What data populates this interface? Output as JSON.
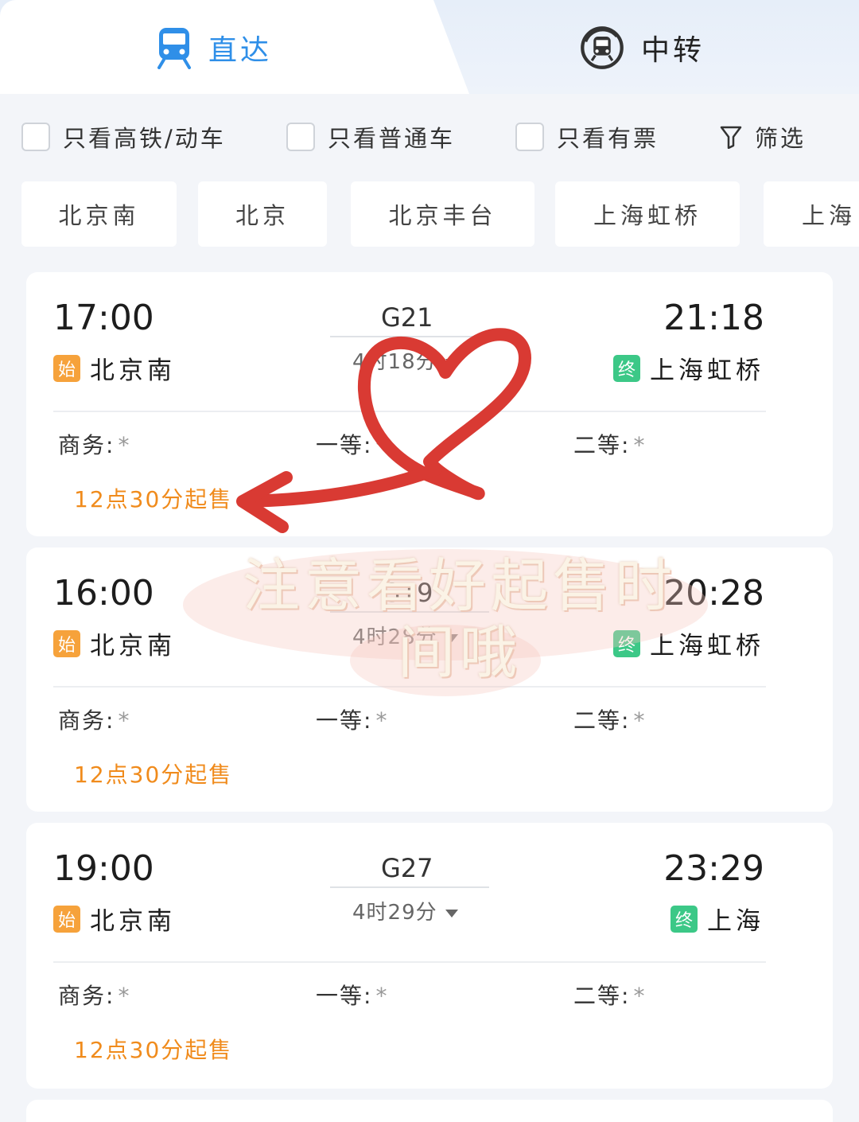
{
  "tabs": [
    {
      "label": "直达",
      "icon": "train-icon",
      "active": true
    },
    {
      "label": "中转",
      "icon": "transfer-train-icon",
      "active": false
    }
  ],
  "filters": {
    "high_speed_only": "只看高铁/动车",
    "regular_only": "只看普通车",
    "available_only": "只看有票",
    "filter_label": "筛选"
  },
  "stations": [
    "北京南",
    "北京",
    "北京丰台",
    "上海虹桥",
    "上海"
  ],
  "seat_labels": {
    "business": "商务:",
    "first": "一等:",
    "second": "二等:"
  },
  "badges": {
    "start": "始",
    "end": "终"
  },
  "trains": [
    {
      "depart_time": "17:00",
      "depart_station": "北京南",
      "train_no": "G21",
      "duration": "4时18分",
      "arrive_time": "21:18",
      "arrive_station": "上海虹桥",
      "business": "*",
      "first": "*",
      "second": "*",
      "sale_text": "12点30分起售"
    },
    {
      "depart_time": "16:00",
      "depart_station": "北京南",
      "train_no": "G19",
      "duration": "4时28分",
      "arrive_time": "20:28",
      "arrive_station": "上海虹桥",
      "business": "*",
      "first": "*",
      "second": "*",
      "sale_text": "12点30分起售"
    },
    {
      "depart_time": "19:00",
      "depart_station": "北京南",
      "train_no": "G27",
      "duration": "4时29分",
      "arrive_time": "23:29",
      "arrive_station": "上海",
      "business": "*",
      "first": "*",
      "second": "*",
      "sale_text": "12点30分起售"
    }
  ],
  "overlay": {
    "note_line1": "注意看好起售时",
    "note_line2": "间哦",
    "heart_color": "#d93a33"
  },
  "colors": {
    "accent": "#2f8fe8",
    "sale_orange": "#f08b1c",
    "start_badge": "#f6a23b",
    "end_badge": "#3cc887"
  }
}
